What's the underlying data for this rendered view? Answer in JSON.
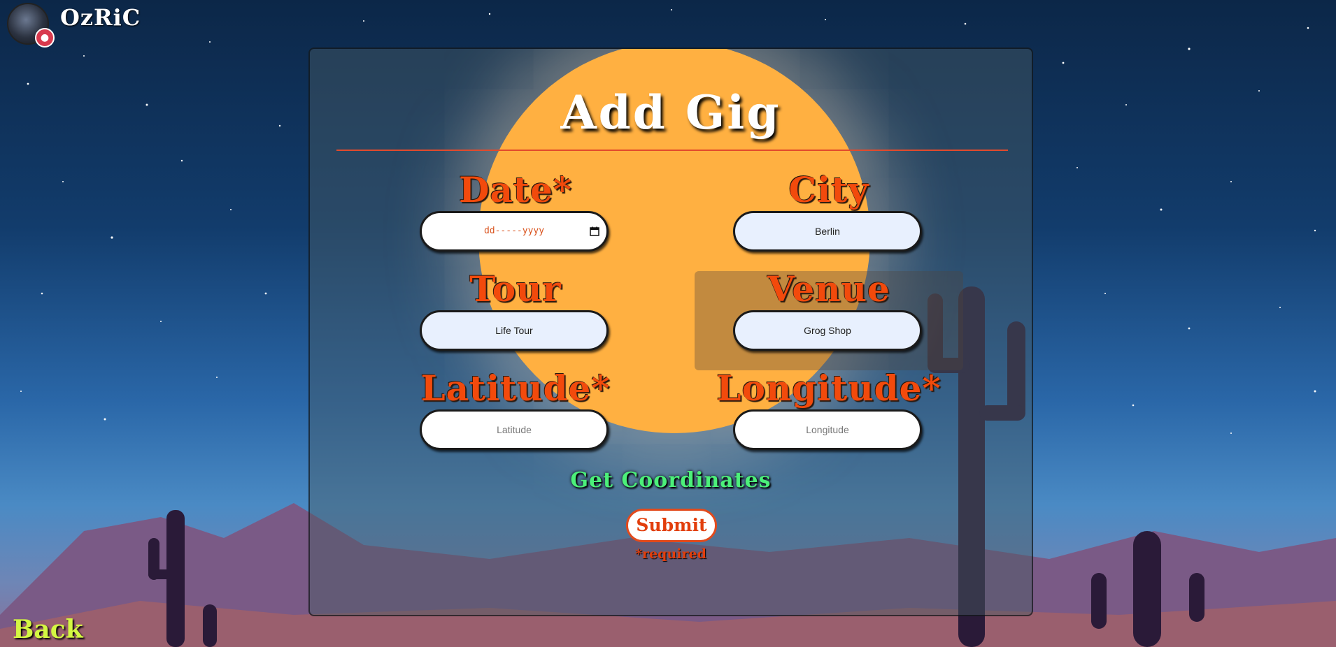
{
  "header": {
    "brand": "OzRiC",
    "logo_icon": "vinyl-record-logo-icon",
    "badge_icon": "chat-bubble-icon"
  },
  "form": {
    "title": "Add Gig",
    "date": {
      "label": "Date*",
      "placeholder": "dd-----yyyy"
    },
    "city": {
      "label": "City",
      "value": "Berlin"
    },
    "tour": {
      "label": "Tour",
      "value": "Life Tour"
    },
    "venue": {
      "label": "Venue",
      "value": "Grog Shop"
    },
    "latitude": {
      "label": "Latitude*",
      "placeholder": "Latitude"
    },
    "longitude": {
      "label": "Longitude*",
      "placeholder": "Longitude"
    },
    "get_coordinates_label": "Get Coordinates",
    "submit_label": "Submit",
    "required_note": "*required"
  },
  "nav": {
    "back_label": "Back"
  },
  "colors": {
    "label": "#f24a0c",
    "moon": "#ffb041",
    "coordinates_button": "#4cf07a",
    "back_link": "#d4f742",
    "input_filled": "#e8f0fe"
  }
}
